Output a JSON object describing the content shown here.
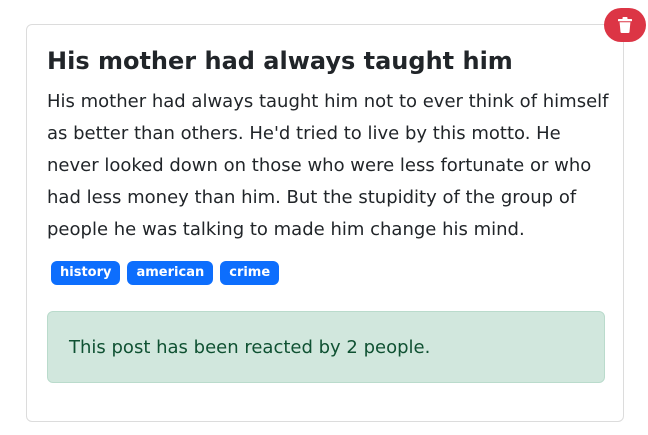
{
  "post": {
    "title": "His mother had always taught him",
    "body": "His mother had always taught him not to ever think of himself as better than others. He'd tried to live by this motto. He never looked down on those who were less fortunate or who had less money than him. But the stupidity of the group of people he was talking to made him change his mind.",
    "tags": [
      "history",
      "american",
      "crime"
    ],
    "reaction_message": "This post has been reacted by 2 people."
  },
  "delete_button": {
    "icon": "trash-icon"
  },
  "colors": {
    "delete": "#dc3545",
    "tag": "#0d6efd",
    "reaction_bg": "#d1e7dd",
    "reaction_text": "#0f5132"
  }
}
